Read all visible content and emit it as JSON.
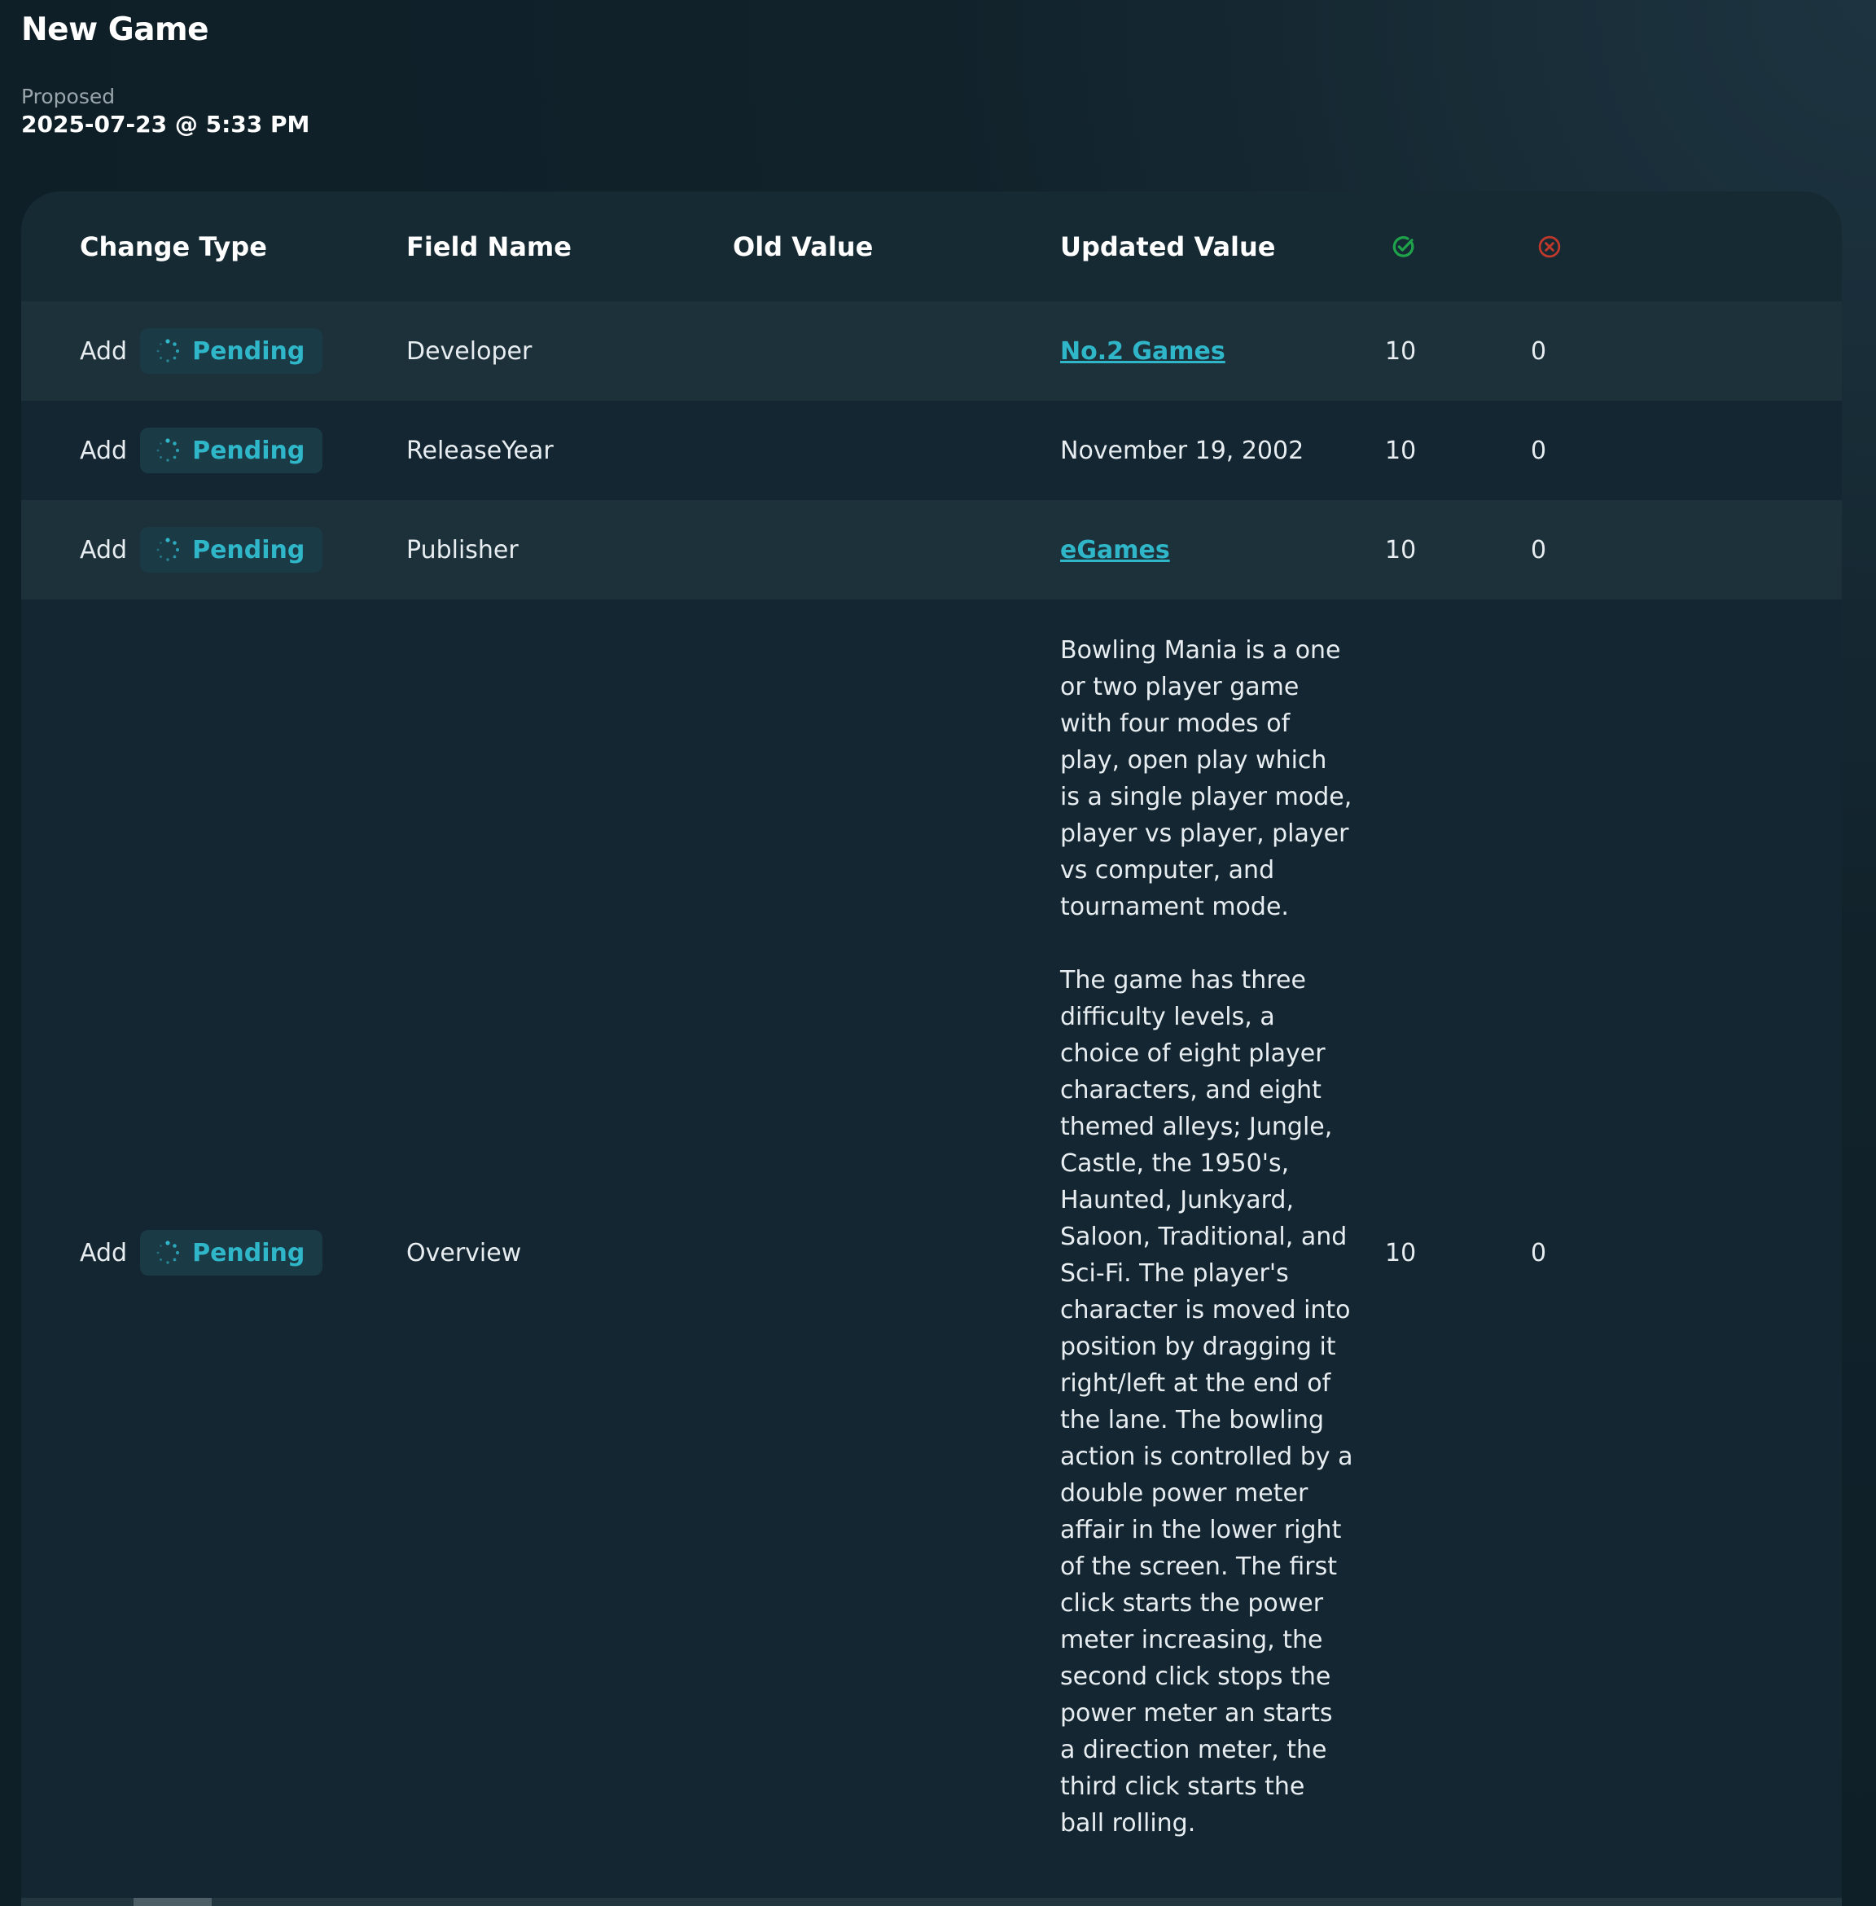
{
  "page": {
    "title": "New Game",
    "proposed_label": "Proposed",
    "proposed_value": "2025-07-23 @ 5:33 PM"
  },
  "table": {
    "headers": {
      "change_type": "Change Type",
      "field_name": "Field Name",
      "old_value": "Old Value",
      "updated_value": "Updated Value",
      "approve_icon": "check-circle-icon",
      "reject_icon": "x-circle-icon"
    },
    "rows": [
      {
        "change_type": "Add",
        "status": "Pending",
        "field_name": "Developer",
        "old_value": "",
        "updated_value": "No.2 Games",
        "updated_is_link": true,
        "approvals": "10",
        "rejections": "0"
      },
      {
        "change_type": "Add",
        "status": "Pending",
        "field_name": "ReleaseYear",
        "old_value": "",
        "updated_value": "November 19, 2002",
        "updated_is_link": false,
        "approvals": "10",
        "rejections": "0"
      },
      {
        "change_type": "Add",
        "status": "Pending",
        "field_name": "Publisher",
        "old_value": "",
        "updated_value": "eGames",
        "updated_is_link": true,
        "approvals": "10",
        "rejections": "0"
      },
      {
        "change_type": "Add",
        "status": "Pending",
        "field_name": "Overview",
        "old_value": "",
        "updated_value_p1": "Bowling Mania is a one or two player game with four modes of play, open play which is a single player mode, player vs player, player vs computer, and tournament mode.",
        "updated_value_p2": "The game has three difficulty levels, a choice of eight player characters, and eight themed alleys; Jungle, Castle, the 1950's, Haunted, Junkyard, Saloon, Traditional, and Sci-Fi. The player's character is moved into position by dragging it right/left at the end of the lane. The bowling action is controlled by a double power meter affair in the lower right of the screen. The first click starts the power meter increasing, the second click stops the power meter an starts a direction meter, the third click starts the ball rolling.",
        "updated_is_link": false,
        "approvals": "10",
        "rejections": "0"
      }
    ]
  },
  "colors": {
    "accent": "#2fb6c9",
    "approve": "#1fa34a",
    "reject": "#c0392b"
  }
}
